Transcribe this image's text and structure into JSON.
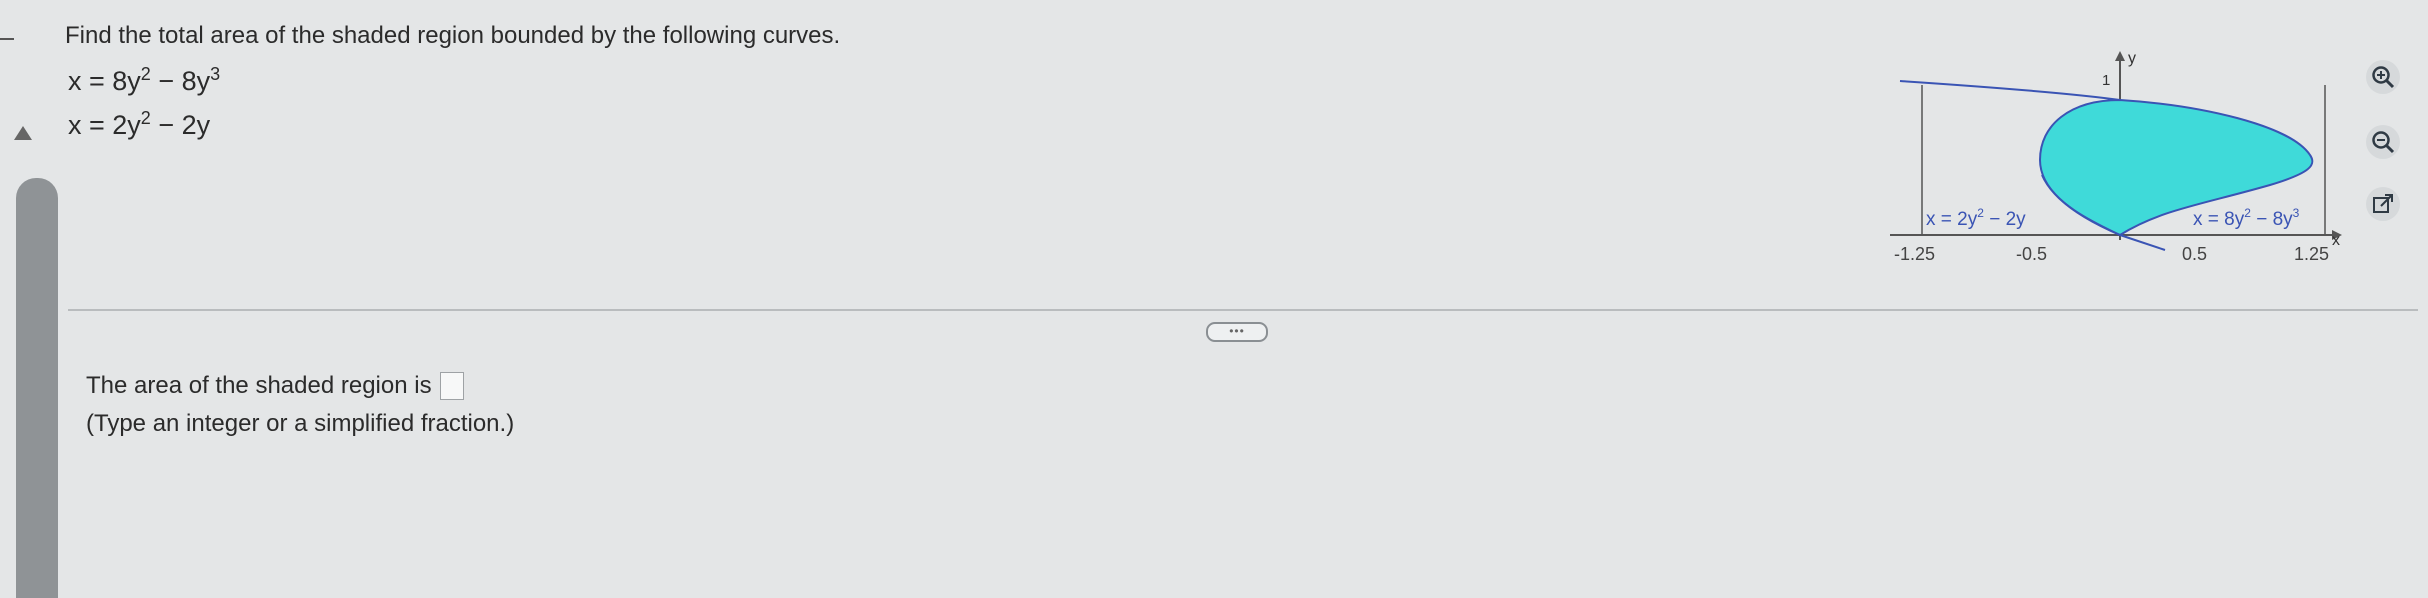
{
  "question": {
    "prompt": "Find the total area of the shaded region bounded by the following curves.",
    "curve1": {
      "lhs": "x = 8y",
      "exp1": "2",
      "mid": " − 8y",
      "exp2": "3"
    },
    "curve2": {
      "lhs": "x = 2y",
      "exp1": "2",
      "mid": " − 2y"
    }
  },
  "graph": {
    "label_left": {
      "base": "x = 2y",
      "exp": "2",
      "tail": " − 2y"
    },
    "label_right": {
      "base": "x = 8y",
      "exp": "2",
      "mid": " − 8y",
      "exp2": "3"
    },
    "axis_x_label": "x",
    "axis_y_label": "y",
    "y_tick_label": "1",
    "x_ticks": [
      "-1.25",
      "-0.5",
      "0.5",
      "1.25"
    ],
    "fill_color": "#3fdad9",
    "curve_color": "#3a54b4"
  },
  "tools": {
    "zoom_in_icon": "magnifier-plus-icon",
    "zoom_out_icon": "magnifier-minus-icon",
    "popout_icon": "external-link-icon"
  },
  "divider_handle": "•••",
  "answer": {
    "prefix": "The area of the shaded region is",
    "value": "",
    "hint": "(Type an integer or a simplified fraction.)"
  }
}
